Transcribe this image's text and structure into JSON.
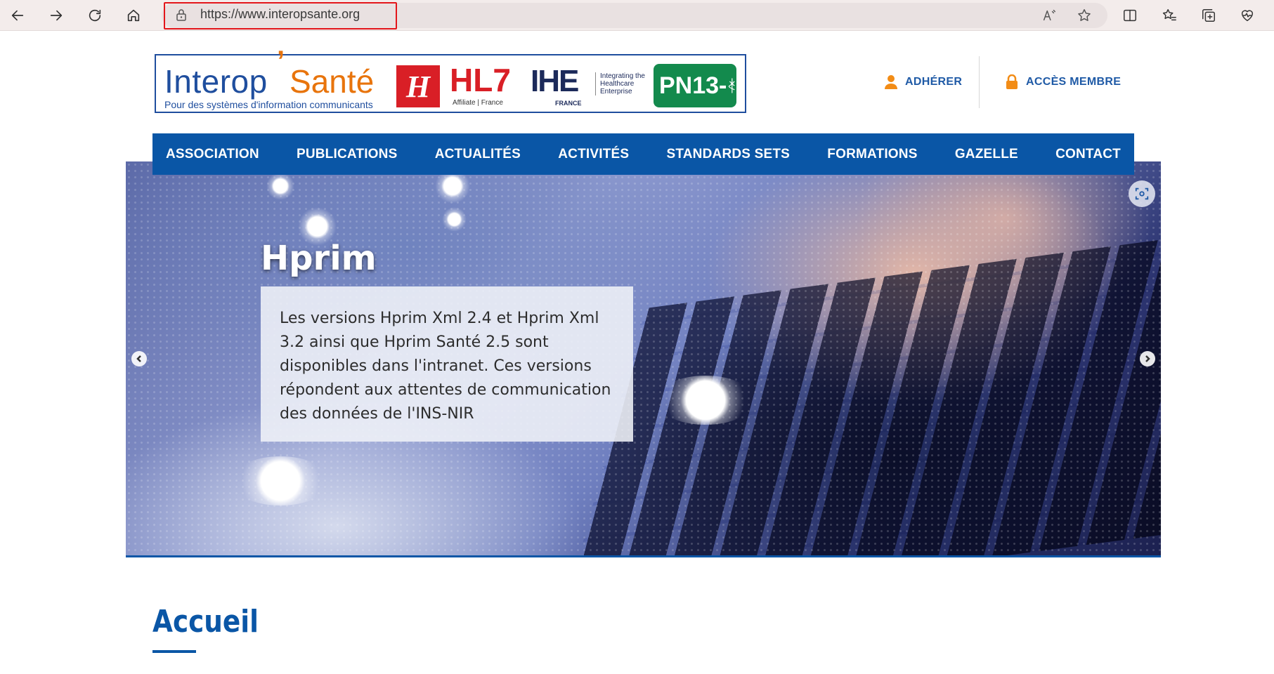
{
  "browser": {
    "url": "https://www.interopsante.org",
    "back_icon": "arrow-left-icon",
    "forward_icon": "arrow-right-icon",
    "refresh_icon": "refresh-icon",
    "home_icon": "home-icon"
  },
  "logo": {
    "interop": "Interop",
    "sante": "Santé",
    "tagline": "Pour des systèmes d'information communicants",
    "h_mark": "H",
    "hl7": "HL7",
    "hl7_sub": "Affiliate | France",
    "ihe": "IHE",
    "ihe_sub": "FRANCE",
    "ihe_desc": "Integrating the Healthcare Enterprise",
    "pn13": "PN13-"
  },
  "header": {
    "join_label": "ADHÉRER",
    "member_label": "ACCÈS MEMBRE"
  },
  "nav": {
    "items": [
      {
        "label": "ASSOCIATION"
      },
      {
        "label": "PUBLICATIONS"
      },
      {
        "label": "ACTUALITÉS"
      },
      {
        "label": "ACTIVITÉS"
      },
      {
        "label": "STANDARDS SETS"
      },
      {
        "label": "FORMATIONS"
      },
      {
        "label": "GAZELLE"
      },
      {
        "label": "CONTACT"
      }
    ]
  },
  "hero": {
    "title": "Hprim",
    "text": "Les versions Hprim Xml 2.4 et Hprim Xml 3.2 ainsi que Hprim Santé 2.5 sont disponibles dans l'intranet. Ces versions répondent aux attentes de communication des données de l'INS-NIR"
  },
  "main": {
    "page_title": "Accueil"
  },
  "colors": {
    "brand_blue": "#0a56a6",
    "accent_orange": "#f28c16",
    "highlight_red": "#e3161b"
  }
}
